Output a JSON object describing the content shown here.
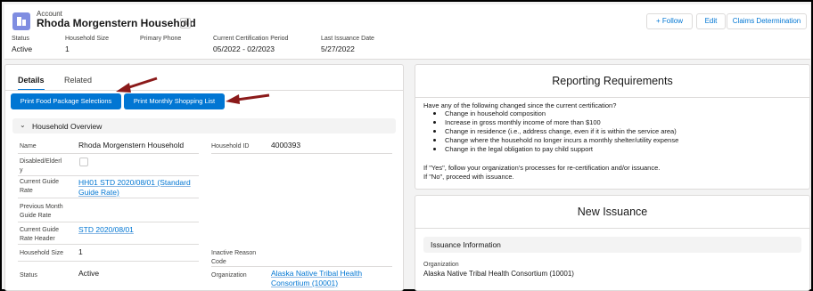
{
  "header": {
    "object_type": "Account",
    "title": "Rhoda Morgenstern Household",
    "buttons": {
      "follow": "Follow",
      "edit": "Edit",
      "claims": "Claims Determination"
    },
    "fields": [
      {
        "label": "Status",
        "value": "Active"
      },
      {
        "label": "Household Size",
        "value": "1"
      },
      {
        "label": "Primary Phone",
        "value": ""
      },
      {
        "label": "Current Certification Period",
        "value": "05/2022 - 02/2023"
      },
      {
        "label": "Last Issuance Date",
        "value": "5/27/2022"
      }
    ]
  },
  "tabs": {
    "details": "Details",
    "related": "Related"
  },
  "actions": {
    "print_food": "Print Food Package Selections",
    "print_shopping": "Print Monthly Shopping List"
  },
  "overview": {
    "section_title": "Household Overview",
    "name_label": "Name",
    "name_value": "Rhoda Morgenstern Household",
    "household_id_label": "Household ID",
    "household_id_value": "4000393",
    "disabled_label_1": "Disabled/Elderl",
    "disabled_label_2": "y",
    "guide_rate_label_1": "Current Guide",
    "guide_rate_label_2": "Rate",
    "guide_rate_value_1": "HH01 STD 2020/08/01 (Standard",
    "guide_rate_value_2": "Guide Rate)",
    "prev_guide_label_1": "Previous Month",
    "prev_guide_label_2": "Guide Rate",
    "guide_header_label_1": "Current Guide",
    "guide_header_label_2": "Rate Header",
    "guide_header_value": "STD 2020/08/01",
    "household_size_label": "Household Size",
    "household_size_value": "1",
    "inactive_reason_label_1": "Inactive Reason",
    "inactive_reason_label_2": "Code",
    "status_label": "Status",
    "status_value": "Active",
    "organization_label": "Organization",
    "organization_value_1": "Alaska Native Tribal Health",
    "organization_value_2": "Consortium (10001)"
  },
  "reporting": {
    "title": "Reporting Requirements",
    "question": "Have any of the following changed since the current certification?",
    "items": [
      "Change in household composition",
      "Increase in gross monthly income of more than $100",
      "Change in residence (i.e., address change, even if it is within the service area)",
      "Change where the household no longer incurs a monthly shelter/utility expense",
      "Change in the legal obligation to pay child support"
    ],
    "yes_text": "If \"Yes\", follow your organization's processes for re-certification and/or issuance.",
    "no_text": "If \"No\", proceed with issuance."
  },
  "issuance": {
    "title": "New Issuance",
    "section": "Issuance Information",
    "org_label": "Organization",
    "org_value": "Alaska Native Tribal Health Consortium (10001)"
  },
  "colors": {
    "brand": "#0176d3",
    "arrow": "#8b1a1a",
    "icon": "#7f8de1"
  }
}
